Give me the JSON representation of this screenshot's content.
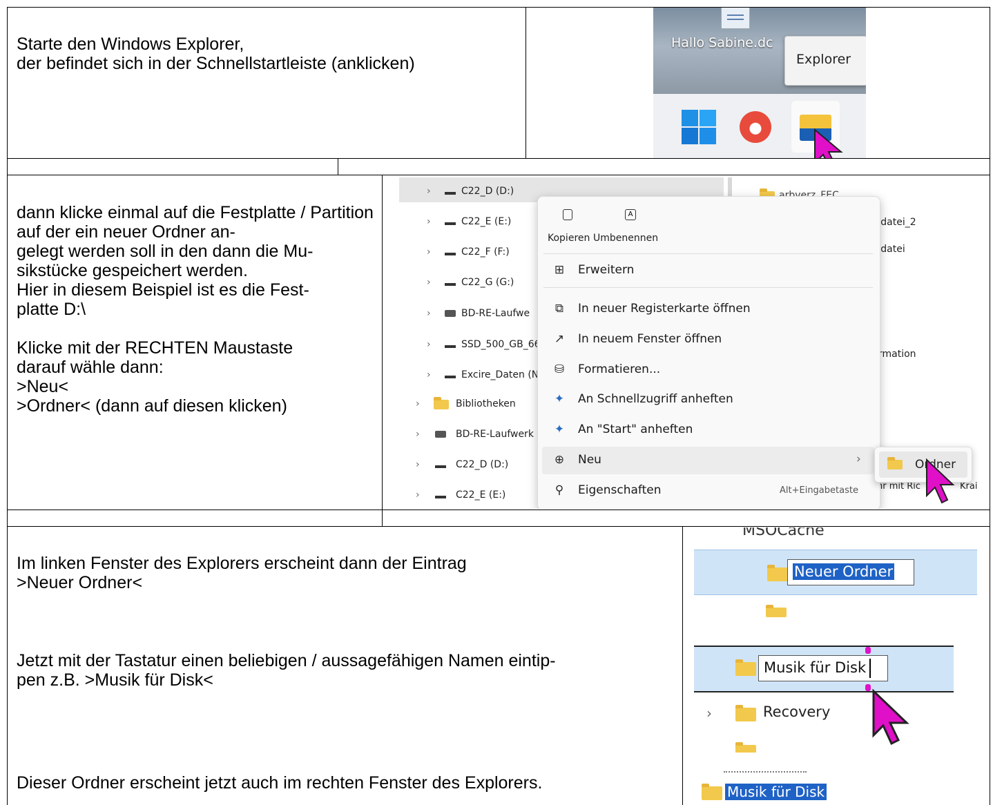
{
  "section1": {
    "text": "Starte den Windows Explorer,\nder befindet sich in der Schnellstartleiste (anklicken)",
    "screenshot": {
      "desktop_file": "Hallo Sabine.dc",
      "tooltip": "Explorer",
      "taskbar_icons": [
        "windows-start-icon",
        "firefox-icon",
        "file-explorer-icon"
      ]
    }
  },
  "section2": {
    "text": "dann klicke einmal auf die Festplatte / Partition auf der ein neuer Ordner an-\ngelegt werden soll in den dann die Mu-\nsikstücke gespeichert werden.\nHier in diesem Beispiel ist es die Fest-\nplatte D:\\\n\nKlicke mit der RECHTEN Maustaste\ndarauf wähle dann:\n>Neu<\n>Ordner< (dann auf diesen klicken)",
    "tree_items": [
      "C22_D (D:)",
      "C22_E (E:)",
      "C22_F (F:)",
      "C22_G (G:)",
      "BD-RE-Laufwe",
      "SSD_500_GB_66",
      "Excire_Daten (N",
      "Bibliotheken",
      "BD-RE-Laufwerk",
      "C22_D (D:)",
      "C22_E (E:)"
    ],
    "right_items": [
      "arbverz_FEC",
      "sdatei_2",
      "sdatei",
      "rmation",
      "hr mit Ric",
      "Krai"
    ],
    "context_menu": {
      "top_actions": [
        "Kopieren",
        "Umbenennen"
      ],
      "items": [
        {
          "icon": "expand-icon",
          "label": "Erweitern"
        },
        {
          "icon": "new-tab-icon",
          "label": "In neuer Registerkarte öffnen"
        },
        {
          "icon": "new-window-icon",
          "label": "In neuem Fenster öffnen"
        },
        {
          "icon": "format-icon",
          "label": "Formatieren..."
        },
        {
          "icon": "pin-icon",
          "label": "An Schnellzugriff anheften"
        },
        {
          "icon": "pin-icon",
          "label": "An \"Start\" anheften"
        },
        {
          "icon": "plus-circle-icon",
          "label": "Neu"
        },
        {
          "icon": "wrench-icon",
          "label": "Eigenschaften"
        }
      ],
      "shortcut": "Alt+Eingabetaste",
      "submenu_item": "Ordner"
    }
  },
  "section3": {
    "text1": "Im linken Fenster des Explorers erscheint dann der Eintrag\n>Neuer Ordner<",
    "text2": "Jetzt mit der Tastatur einen beliebigen / aussagefähigen Namen eintip-\npen z.B. >Musik für Disk<",
    "text3": "Dieser Ordner erscheint jetzt auch im rechten Fenster des Explorers.",
    "shot_a": {
      "partial_above": "MSOCache",
      "edit_value": "Neuer Ordner"
    },
    "shot_b": {
      "edit_value": "Musik für Disk",
      "below": "Recovery"
    },
    "shot_c": {
      "selected": "Musik für Disk"
    }
  },
  "colors": {
    "accent_pink": "#e00fc8",
    "selection_blue": "#cfe4f7",
    "folder_yellow": "#f2c94c"
  }
}
